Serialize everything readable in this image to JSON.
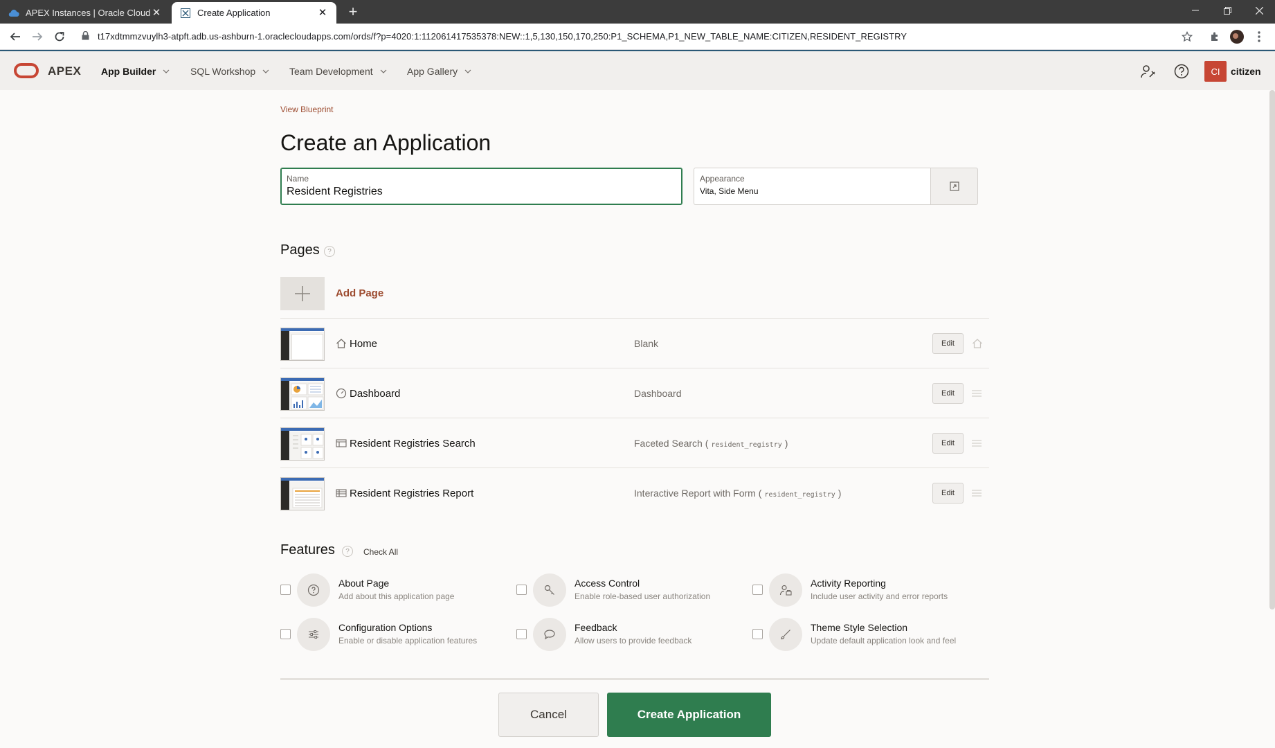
{
  "browser": {
    "tabs": [
      {
        "label": "APEX Instances | Oracle Cloud Inf",
        "icon": "cloud-icon",
        "active": false
      },
      {
        "label": "Create Application",
        "icon": "apex-tab-icon",
        "active": true
      }
    ],
    "close_glyph": "✕",
    "new_tab_glyph": "+",
    "url": "t17xdtmmzvuylh3-atpft.adb.us-ashburn-1.oraclecloudapps.com/ords/f?p=4020:1:112061417535378:NEW::1,5,130,150,170,250:P1_SCHEMA,P1_NEW_TABLE_NAME:CITIZEN,RESIDENT_REGISTRY"
  },
  "header": {
    "product": "APEX",
    "nav": [
      {
        "label": "App Builder",
        "active": true
      },
      {
        "label": "SQL Workshop",
        "active": false
      },
      {
        "label": "Team Development",
        "active": false
      },
      {
        "label": "App Gallery",
        "active": false
      }
    ],
    "avatar_initials": "CI",
    "username": "citizen",
    "accent": "#c74634",
    "bar_border": "#2b5876"
  },
  "main": {
    "view_blueprint": "View Blueprint",
    "title": "Create an Application",
    "name_field": {
      "label": "Name",
      "value": "Resident Registries"
    },
    "appearance_field": {
      "label": "Appearance",
      "value": "Vita, Side Menu"
    },
    "pages_heading": "Pages",
    "add_page": "Add Page",
    "pages": [
      {
        "name": "Home",
        "icon": "home-icon",
        "kind": "Blank",
        "table": "",
        "edit": "Edit",
        "tail": "home-icon"
      },
      {
        "name": "Dashboard",
        "icon": "dashboard-icon",
        "kind": "Dashboard",
        "table": "",
        "edit": "Edit",
        "tail": "drag-handle-icon"
      },
      {
        "name": "Resident Registries Search",
        "icon": "faceted-search-icon",
        "kind": "Faceted Search (",
        "table": "resident_registry",
        "kind_close": ")",
        "edit": "Edit",
        "tail": "drag-handle-icon"
      },
      {
        "name": "Resident Registries Report",
        "icon": "report-icon",
        "kind": "Interactive Report with Form (",
        "table": "resident_registry",
        "kind_close": ")",
        "edit": "Edit",
        "tail": "drag-handle-icon"
      }
    ],
    "features_heading": "Features",
    "check_all": "Check All",
    "features": [
      {
        "title": "About Page",
        "desc": "Add about this application page",
        "icon": "question-icon",
        "checked": false
      },
      {
        "title": "Access Control",
        "desc": "Enable role-based user authorization",
        "icon": "key-icon",
        "checked": false
      },
      {
        "title": "Activity Reporting",
        "desc": "Include user activity and error reports",
        "icon": "user-activity-icon",
        "checked": false
      },
      {
        "title": "Configuration Options",
        "desc": "Enable or disable application features",
        "icon": "sliders-icon",
        "checked": false
      },
      {
        "title": "Feedback",
        "desc": "Allow users to provide feedback",
        "icon": "speech-bubble-icon",
        "checked": false
      },
      {
        "title": "Theme Style Selection",
        "desc": "Update default application look and feel",
        "icon": "brush-icon",
        "checked": false
      }
    ],
    "cancel": "Cancel",
    "create": "Create Application",
    "primary_color": "#2f7d4f"
  }
}
